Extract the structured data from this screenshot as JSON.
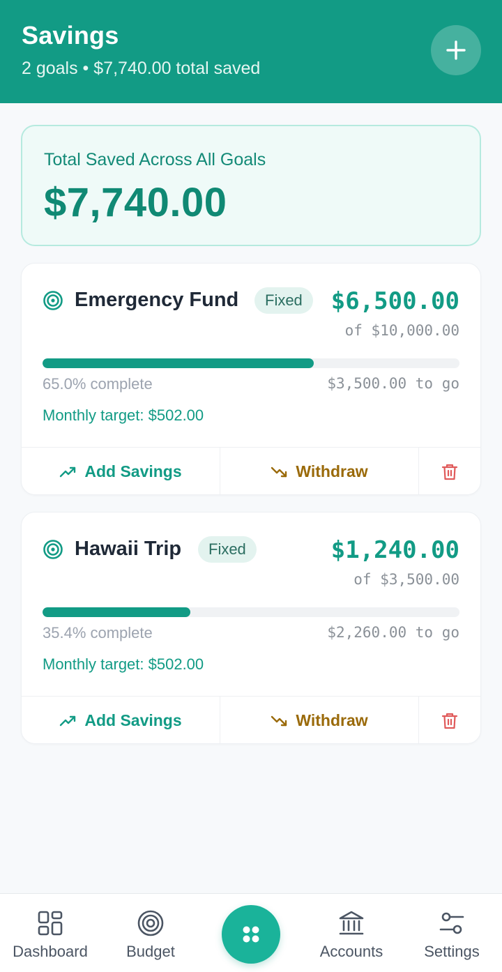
{
  "header": {
    "title": "Savings",
    "subtitle": "2 goals • $7,740.00 total saved",
    "add_icon": "plus-icon"
  },
  "summary": {
    "label": "Total Saved Across All Goals",
    "amount": "$7,740.00"
  },
  "goals": [
    {
      "name": "Emergency Fund",
      "badge": "Fixed",
      "saved": "$6,500.00",
      "target": "of $10,000.00",
      "progress_fraction": 0.65,
      "percent_label": "65.0% complete",
      "to_go": "$3,500.00 to go",
      "monthly": "Monthly target: $502.00",
      "add_label": "Add Savings",
      "withdraw_label": "Withdraw"
    },
    {
      "name": "Hawaii Trip",
      "badge": "Fixed",
      "saved": "$1,240.00",
      "target": "of $3,500.00",
      "progress_fraction": 0.354,
      "percent_label": "35.4% complete",
      "to_go": "$2,260.00 to go",
      "monthly": "Monthly target: $502.00",
      "add_label": "Add Savings",
      "withdraw_label": "Withdraw"
    }
  ],
  "nav": {
    "items": [
      {
        "label": "Dashboard",
        "icon": "dashboard-icon"
      },
      {
        "label": "Budget",
        "icon": "target-icon"
      },
      {
        "label": "Accounts",
        "icon": "bank-icon"
      },
      {
        "label": "Settings",
        "icon": "sliders-icon"
      }
    ],
    "center_icon": "grid-dots-icon"
  },
  "colors": {
    "primary": "#129b85",
    "summary_bg": "#effaf8",
    "withdraw": "#9a6a0a",
    "delete": "#e05a5a"
  }
}
